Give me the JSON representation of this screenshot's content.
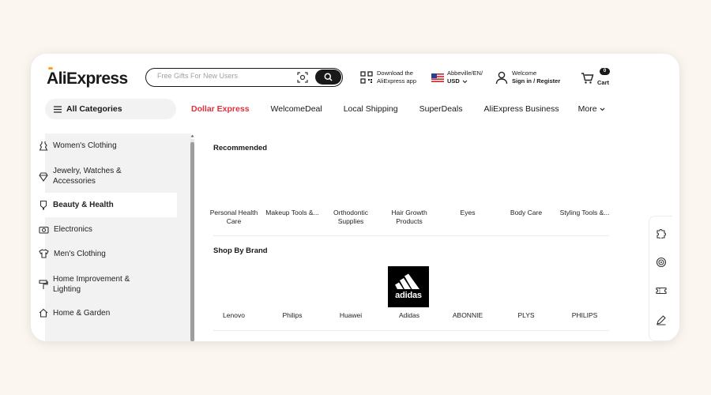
{
  "header": {
    "logo": "AliExpress",
    "search_placeholder": "Free Gifts For New Users",
    "app": {
      "line1": "Download the",
      "line2": "AliExpress app"
    },
    "locale": {
      "line1": "Abbeville/EN/",
      "line2": "USD"
    },
    "account": {
      "line1": "Welcome",
      "line2": "Sign in / Register"
    },
    "cart": {
      "count": "0",
      "label": "Cart"
    }
  },
  "nav": {
    "all_categories": "All Categories",
    "links": [
      "Dollar Express",
      "WelcomeDeal",
      "Local Shipping",
      "SuperDeals",
      "AliExpress Business",
      "More"
    ]
  },
  "sidebar": {
    "items": [
      {
        "label": "Women's Clothing",
        "icon": "dress-icon"
      },
      {
        "label": "Jewelry, Watches & Accessories",
        "icon": "jewel-icon"
      },
      {
        "label": "Beauty & Health",
        "icon": "lipstick-icon",
        "active": true
      },
      {
        "label": "Electronics",
        "icon": "camera-icon"
      },
      {
        "label": "Men's Clothing",
        "icon": "shirt-icon"
      },
      {
        "label": "Home Improvement & Lighting",
        "icon": "paint-roller-icon"
      },
      {
        "label": "Home & Garden",
        "icon": "house-icon"
      }
    ]
  },
  "recommended": {
    "title": "Recommended",
    "items": [
      "Personal Health Care",
      "Makeup Tools &...",
      "Orthodontic Supplies",
      "Hair Growth Products",
      "Eyes",
      "Body Care",
      "Styling Tools &..."
    ]
  },
  "brands": {
    "title": "Shop By Brand",
    "items": [
      "Lenovo",
      "Philips",
      "Huawei",
      "Adidas",
      "ABONNIE",
      "PLYS",
      "PHILIPS"
    ],
    "adidas_logo_text": "adidas"
  },
  "colors": {
    "accent_red": "#e02f3d",
    "logo_orange": "#f5a623",
    "dark": "#191919",
    "sidebar_bg": "#f2f2f2"
  }
}
